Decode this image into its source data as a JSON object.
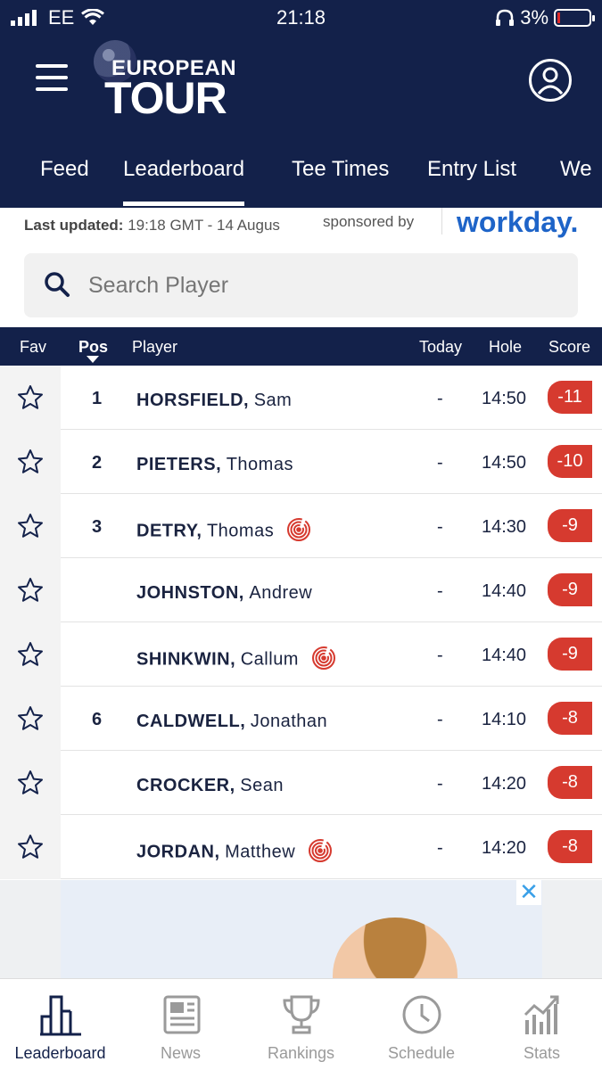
{
  "status_bar": {
    "carrier": "EE",
    "time": "21:18",
    "battery": "3%",
    "battery_level": 0.03,
    "icons": [
      "signal-icon",
      "wifi-icon",
      "headphones-icon",
      "battery-icon"
    ]
  },
  "header": {
    "logo_line1": "EUROPEAN",
    "logo_line2": "TOUR",
    "menu_icon": "hamburger-icon",
    "profile_icon": "user-icon"
  },
  "tabs": [
    {
      "label": "Feed",
      "active": false
    },
    {
      "label": "Leaderboard",
      "active": true
    },
    {
      "label": "Tee Times",
      "active": false
    },
    {
      "label": "Entry List",
      "active": false
    },
    {
      "label": "We",
      "active": false
    }
  ],
  "info": {
    "last_updated_label": "Last updated:",
    "last_updated_value": "19:18 GMT - 14 Augus",
    "sponsored_by": "sponsored by",
    "sponsor_name": "workday."
  },
  "search": {
    "placeholder": "Search Player",
    "icon": "search-icon"
  },
  "table_header": {
    "fav": "Fav",
    "pos": "Pos",
    "player": "Player",
    "today": "Today",
    "hole": "Hole",
    "score": "Score"
  },
  "rows": [
    {
      "pos": "1",
      "last": "HORSFIELD,",
      "first": "Sam",
      "badge": false,
      "today": "-",
      "hole": "14:50",
      "score": "-11"
    },
    {
      "pos": "2",
      "last": "PIETERS,",
      "first": "Thomas",
      "badge": false,
      "today": "-",
      "hole": "14:50",
      "score": "-10"
    },
    {
      "pos": "3",
      "last": "DETRY,",
      "first": "Thomas",
      "badge": true,
      "today": "-",
      "hole": "14:30",
      "score": "-9"
    },
    {
      "pos": "",
      "last": "JOHNSTON,",
      "first": "Andrew",
      "badge": false,
      "today": "-",
      "hole": "14:40",
      "score": "-9"
    },
    {
      "pos": "",
      "last": "SHINKWIN,",
      "first": "Callum",
      "badge": true,
      "today": "-",
      "hole": "14:40",
      "score": "-9"
    },
    {
      "pos": "6",
      "last": "CALDWELL,",
      "first": "Jonathan",
      "badge": false,
      "today": "-",
      "hole": "14:10",
      "score": "-8"
    },
    {
      "pos": "",
      "last": "CROCKER,",
      "first": "Sean",
      "badge": false,
      "today": "-",
      "hole": "14:20",
      "score": "-8"
    },
    {
      "pos": "",
      "last": "JORDAN,",
      "first": "Matthew",
      "badge": true,
      "today": "-",
      "hole": "14:20",
      "score": "-8"
    }
  ],
  "ad": {
    "close": "✕"
  },
  "bottom_nav": [
    {
      "label": "Leaderboard",
      "icon": "leaderboard-icon",
      "active": true
    },
    {
      "label": "News",
      "icon": "news-icon",
      "active": false
    },
    {
      "label": "Rankings",
      "icon": "trophy-icon",
      "active": false
    },
    {
      "label": "Schedule",
      "icon": "clock-icon",
      "active": false
    },
    {
      "label": "Stats",
      "icon": "stats-icon",
      "active": false
    }
  ],
  "colors": {
    "navy": "#13214a",
    "score_red": "#d63a2f",
    "sponsor_blue": "#1e64c8"
  }
}
